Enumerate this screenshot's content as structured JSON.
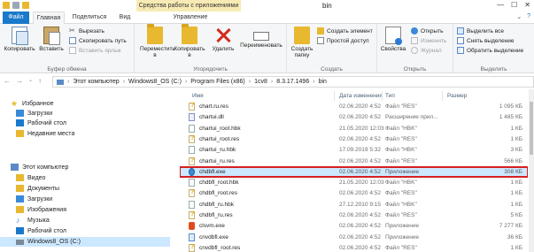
{
  "window": {
    "title": "bin",
    "context_tab_title": "Средства работы с приложениями"
  },
  "tabs": {
    "file": "Файл",
    "home": "Главная",
    "share": "Поделиться",
    "view": "Вид",
    "manage": "Управление"
  },
  "ribbon": {
    "clipboard": {
      "label": "Буфер обмена",
      "copy": "Копировать",
      "paste": "Вставить",
      "cut": "Вырезать",
      "copy_path": "Скопировать путь",
      "paste_shortcut": "Вставить ярлык"
    },
    "organize": {
      "label": "Упорядочить",
      "move_to": "Переместить в",
      "copy_to": "Копировать в",
      "delete": "Удалить",
      "rename": "Переименовать"
    },
    "create": {
      "label": "Создать",
      "new_folder": "Создать папку",
      "new_item": "Создать элемент",
      "easy_access": "Простой доступ"
    },
    "open": {
      "label": "Открыть",
      "properties": "Свойства",
      "open": "Открыть",
      "edit": "Изменить",
      "history": "Журнал"
    },
    "select": {
      "label": "Выделить",
      "select_all": "Выделить все",
      "select_none": "Снять выделение",
      "invert": "Обратить выделение"
    }
  },
  "address": {
    "segments": [
      "Этот компьютер",
      "Windows8_OS (C:)",
      "Program Files (x86)",
      "1cv8",
      "8.3.17.1496",
      "bin"
    ]
  },
  "nav": {
    "favorites": "Избранное",
    "downloads": "Загрузки",
    "desktop": "Рабочий стол",
    "recent": "Недавние места",
    "this_pc": "Этот компьютер",
    "video": "Видео",
    "documents": "Документы",
    "downloads2": "Загрузки",
    "pictures": "Изображения",
    "music": "Музыка",
    "desktop2": "Рабочий стол",
    "drive": "Windows8_OS (C:)"
  },
  "columns": {
    "name": "Имя",
    "date": "Дата изменения",
    "type": "Тип",
    "size": "Размер"
  },
  "files": [
    {
      "name": "chart.ru.res",
      "date": "02.06.2020 4:52",
      "type": "Файл \"RES\"",
      "size": "1 095 КБ",
      "icon": "res"
    },
    {
      "name": "chartui.dll",
      "date": "02.06.2020 4:52",
      "type": "Расширение прил...",
      "size": "1 485 КБ",
      "icon": "dll"
    },
    {
      "name": "chartui_root.hbk",
      "date": "21.05.2020 12:03",
      "type": "Файл \"HBK\"",
      "size": "1 КБ",
      "icon": "doc"
    },
    {
      "name": "chartui_root.res",
      "date": "02.06.2020 4:52",
      "type": "Файл \"RES\"",
      "size": "1 КБ",
      "icon": "res"
    },
    {
      "name": "chartui_ru.hbk",
      "date": "17.09.2019 5:32",
      "type": "Файл \"HBK\"",
      "size": "3 КБ",
      "icon": "doc"
    },
    {
      "name": "chartui_ru.res",
      "date": "02.06.2020 4:52",
      "type": "Файл \"RES\"",
      "size": "566 КБ",
      "icon": "res"
    },
    {
      "name": "chdbfl.exe",
      "date": "02.06.2020 4:52",
      "type": "Приложение",
      "size": "308 КБ",
      "icon": "exe"
    },
    {
      "name": "chdbfl_root.hbk",
      "date": "21.05.2020 12:03",
      "type": "Файл \"HBK\"",
      "size": "1 КБ",
      "icon": "doc"
    },
    {
      "name": "chdbfl_root.res",
      "date": "02.06.2020 4:52",
      "type": "Файл \"RES\"",
      "size": "1 КБ",
      "icon": "res"
    },
    {
      "name": "chdbfl_ru.hbk",
      "date": "27.12.2010 9:15",
      "type": "Файл \"HBK\"",
      "size": "1 КБ",
      "icon": "doc"
    },
    {
      "name": "chdbfl_ru.res",
      "date": "02.06.2020 4:52",
      "type": "Файл \"RES\"",
      "size": "5 КБ",
      "icon": "res"
    },
    {
      "name": "clsvm.exe",
      "date": "02.06.2020 4:52",
      "type": "Приложение",
      "size": "7 277 КБ",
      "icon": "clsvm"
    },
    {
      "name": "cnvdbfl.exe",
      "date": "02.06.2020 4:52",
      "type": "Приложение",
      "size": "36 КБ",
      "icon": "exe2"
    },
    {
      "name": "cnvdbfl_root.res",
      "date": "02.06.2020 4:52",
      "type": "Файл \"RES\"",
      "size": "1 КБ",
      "icon": "res"
    }
  ],
  "selected_file": "chdbfl.exe",
  "colors": {
    "file_tab": "#1979ca",
    "context_tab": "#f8eab4",
    "selection": "#cce8ff",
    "highlight_border": "#d42020"
  }
}
